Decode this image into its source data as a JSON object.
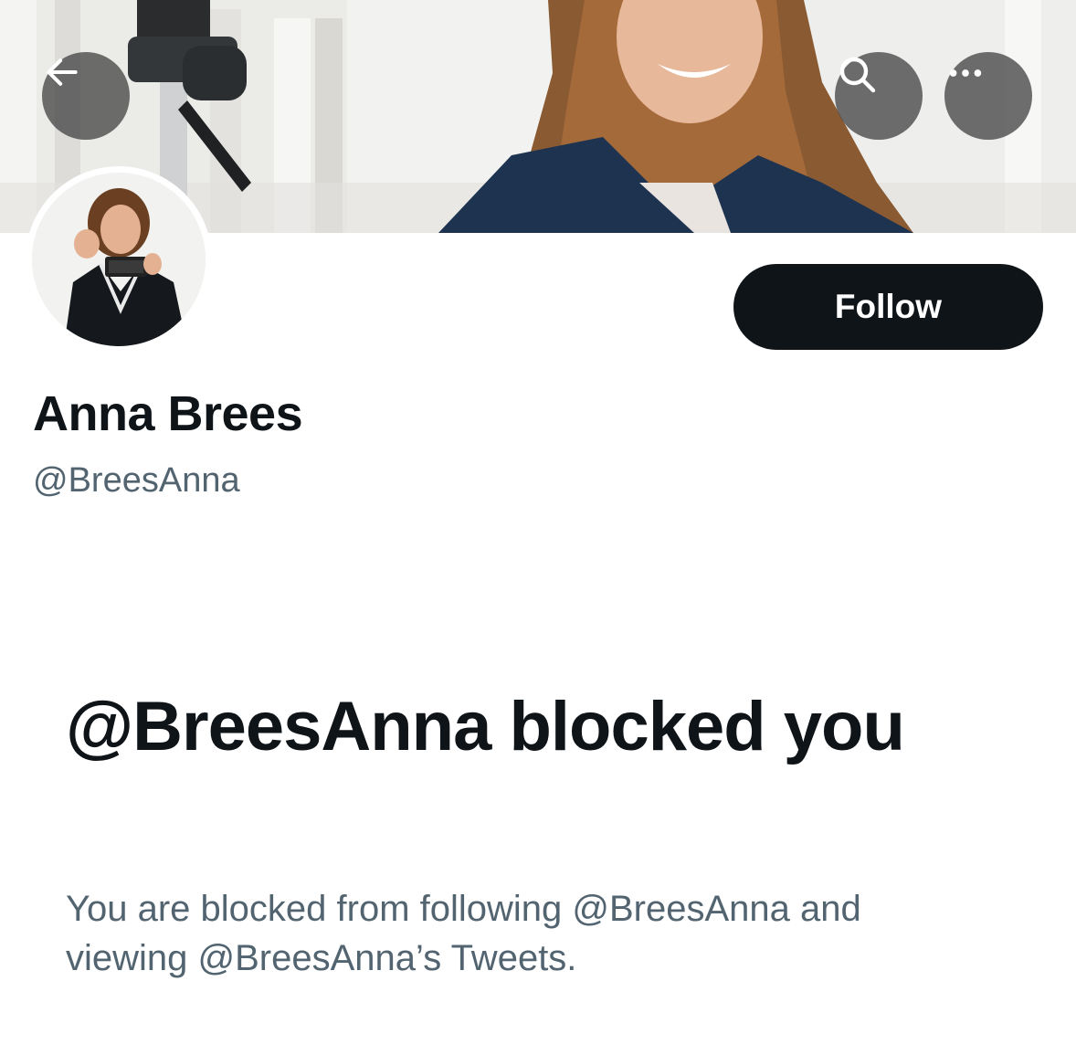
{
  "header": {
    "back_icon": "arrow-left-icon",
    "search_icon": "search-icon",
    "more_icon": "more-horizontal-icon"
  },
  "profile": {
    "display_name": "Anna Brees",
    "handle": "@BreesAnna",
    "follow_label": "Follow"
  },
  "blocked": {
    "title": "@BreesAnna blocked you",
    "description": "You are blocked from following @BreesAnna and viewing @BreesAnna’s Tweets."
  },
  "colors": {
    "text_primary": "#0f1419",
    "text_secondary": "#536471",
    "button_dark": "#0f1419",
    "overlay_button": "#464646"
  }
}
